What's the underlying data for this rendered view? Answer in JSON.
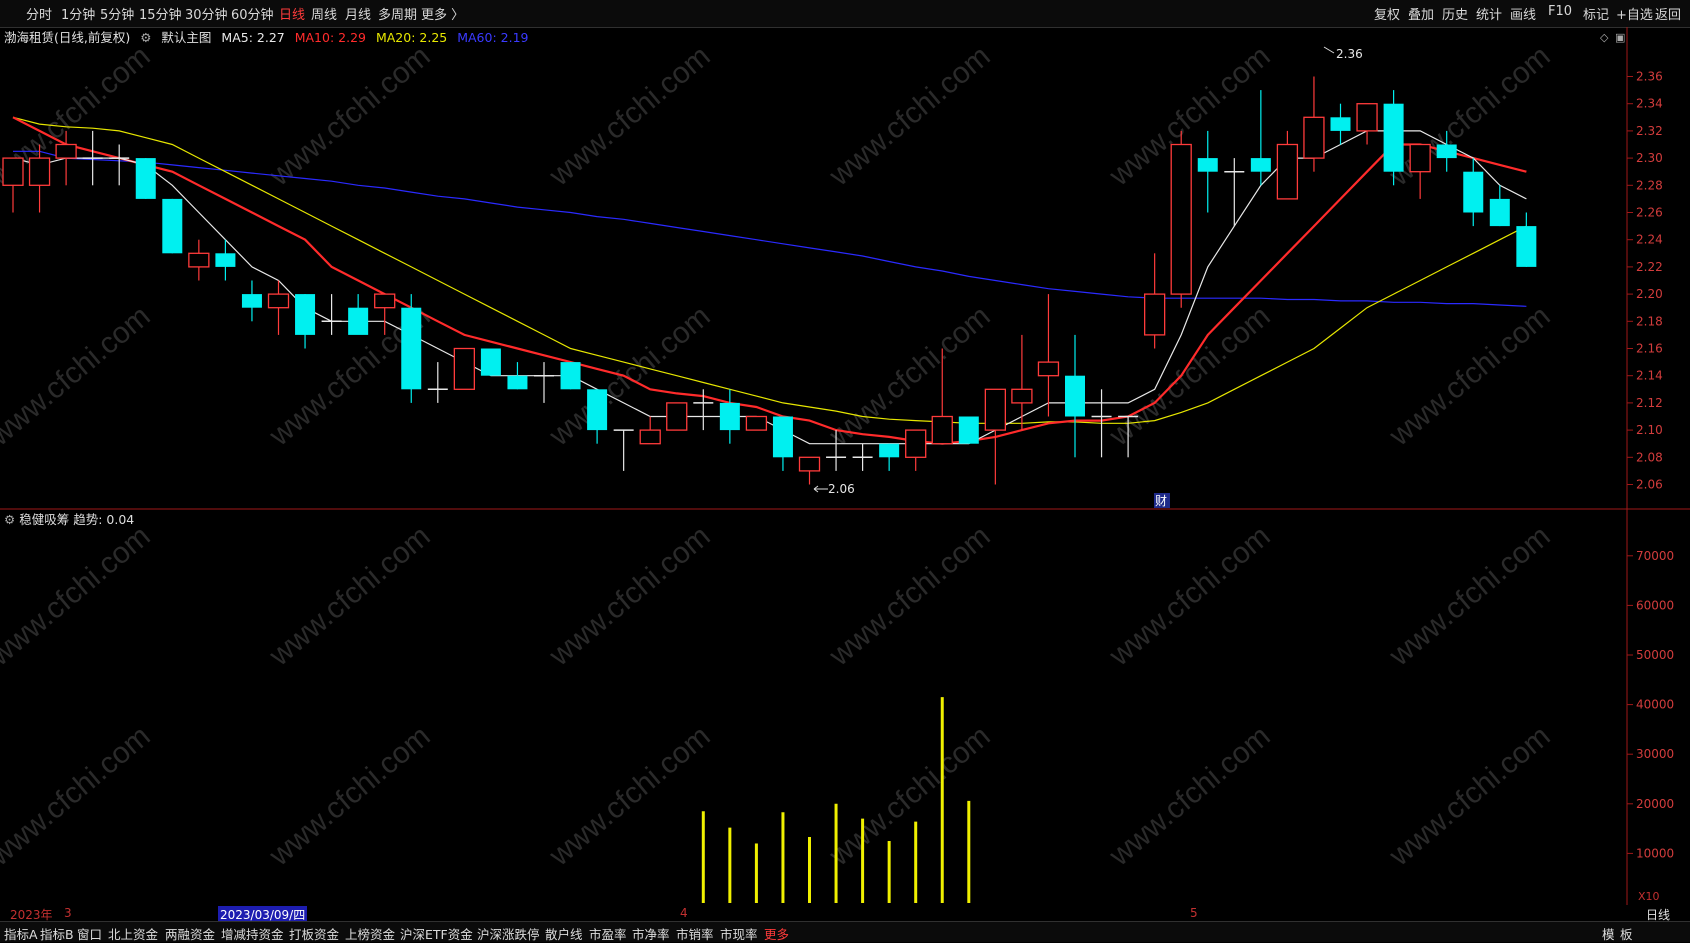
{
  "toolbar": {
    "periods": [
      "分时",
      "1分钟",
      "5分钟",
      "15分钟",
      "30分钟",
      "60分钟",
      "日线",
      "周线",
      "月线",
      "多周期",
      "更多 〉"
    ],
    "active_period": "日线",
    "right_buttons": [
      "复权",
      "叠加",
      "历史",
      "统计",
      "画线",
      "F10",
      "标记",
      "+自选",
      "返回"
    ]
  },
  "main_legend": {
    "stock": "渤海租赁(日线,前复权)",
    "template": "默认主图",
    "ma5": "MA5: 2.27",
    "ma10": "MA10: 2.29",
    "ma20": "MA20: 2.25",
    "ma60": "MA60: 2.19",
    "colors": {
      "ma5": "#e8e8e8",
      "ma10": "#ff2b2b",
      "ma20": "#e6e600",
      "ma60": "#2a2aff",
      "up": "#ff3b3b",
      "down": "#00f0f0"
    }
  },
  "indicator_legend": {
    "name": "稳健吸筹",
    "value": "趋势: 0.04"
  },
  "price_axis": [
    "2.36",
    "2.34",
    "2.32",
    "2.30",
    "2.28",
    "2.26",
    "2.24",
    "2.22",
    "2.20",
    "2.18",
    "2.16",
    "2.14",
    "2.12",
    "2.10",
    "2.08",
    "2.06"
  ],
  "indicator_axis": [
    "70000",
    "60000",
    "50000",
    "40000",
    "30000",
    "20000",
    "10000"
  ],
  "indicator_axis_unit": "X10",
  "annotations": {
    "high": "2.36",
    "low": "2.06",
    "event": "财"
  },
  "watermark": "www.cfchi.com",
  "chart_data": {
    "type": "candlestick",
    "title": "渤海租赁(日线,前复权)",
    "ylim": [
      2.05,
      2.37
    ],
    "candles": [
      {
        "o": 2.28,
        "h": 2.3,
        "l": 2.26,
        "c": 2.3
      },
      {
        "o": 2.28,
        "h": 2.31,
        "l": 2.26,
        "c": 2.3
      },
      {
        "o": 2.3,
        "h": 2.32,
        "l": 2.28,
        "c": 2.31
      },
      {
        "o": 2.3,
        "h": 2.32,
        "l": 2.28,
        "c": 2.3
      },
      {
        "o": 2.3,
        "h": 2.31,
        "l": 2.28,
        "c": 2.3
      },
      {
        "o": 2.3,
        "h": 2.3,
        "l": 2.27,
        "c": 2.27
      },
      {
        "o": 2.27,
        "h": 2.27,
        "l": 2.23,
        "c": 2.23
      },
      {
        "o": 2.22,
        "h": 2.24,
        "l": 2.21,
        "c": 2.23
      },
      {
        "o": 2.23,
        "h": 2.24,
        "l": 2.21,
        "c": 2.22
      },
      {
        "o": 2.2,
        "h": 2.21,
        "l": 2.18,
        "c": 2.19
      },
      {
        "o": 2.19,
        "h": 2.21,
        "l": 2.17,
        "c": 2.2
      },
      {
        "o": 2.2,
        "h": 2.2,
        "l": 2.16,
        "c": 2.17
      },
      {
        "o": 2.18,
        "h": 2.2,
        "l": 2.17,
        "c": 2.18
      },
      {
        "o": 2.19,
        "h": 2.2,
        "l": 2.18,
        "c": 2.17
      },
      {
        "o": 2.19,
        "h": 2.2,
        "l": 2.17,
        "c": 2.2
      },
      {
        "o": 2.19,
        "h": 2.2,
        "l": 2.12,
        "c": 2.13
      },
      {
        "o": 2.13,
        "h": 2.15,
        "l": 2.12,
        "c": 2.13
      },
      {
        "o": 2.13,
        "h": 2.16,
        "l": 2.13,
        "c": 2.16
      },
      {
        "o": 2.16,
        "h": 2.16,
        "l": 2.14,
        "c": 2.14
      },
      {
        "o": 2.14,
        "h": 2.15,
        "l": 2.13,
        "c": 2.13
      },
      {
        "o": 2.14,
        "h": 2.15,
        "l": 2.12,
        "c": 2.14
      },
      {
        "o": 2.15,
        "h": 2.15,
        "l": 2.13,
        "c": 2.13
      },
      {
        "o": 2.13,
        "h": 2.13,
        "l": 2.09,
        "c": 2.1
      },
      {
        "o": 2.1,
        "h": 2.1,
        "l": 2.07,
        "c": 2.1
      },
      {
        "o": 2.09,
        "h": 2.11,
        "l": 2.09,
        "c": 2.1
      },
      {
        "o": 2.1,
        "h": 2.12,
        "l": 2.1,
        "c": 2.12
      },
      {
        "o": 2.12,
        "h": 2.13,
        "l": 2.1,
        "c": 2.12
      },
      {
        "o": 2.12,
        "h": 2.13,
        "l": 2.09,
        "c": 2.1
      },
      {
        "o": 2.1,
        "h": 2.11,
        "l": 2.1,
        "c": 2.11
      },
      {
        "o": 2.11,
        "h": 2.11,
        "l": 2.07,
        "c": 2.08
      },
      {
        "o": 2.07,
        "h": 2.08,
        "l": 2.06,
        "c": 2.08
      },
      {
        "o": 2.08,
        "h": 2.1,
        "l": 2.07,
        "c": 2.08
      },
      {
        "o": 2.08,
        "h": 2.09,
        "l": 2.07,
        "c": 2.08
      },
      {
        "o": 2.09,
        "h": 2.09,
        "l": 2.07,
        "c": 2.08
      },
      {
        "o": 2.08,
        "h": 2.1,
        "l": 2.07,
        "c": 2.1
      },
      {
        "o": 2.09,
        "h": 2.16,
        "l": 2.09,
        "c": 2.11
      },
      {
        "o": 2.11,
        "h": 2.11,
        "l": 2.09,
        "c": 2.09
      },
      {
        "o": 2.1,
        "h": 2.13,
        "l": 2.06,
        "c": 2.13
      },
      {
        "o": 2.12,
        "h": 2.17,
        "l": 2.1,
        "c": 2.13
      },
      {
        "o": 2.14,
        "h": 2.2,
        "l": 2.11,
        "c": 2.15
      },
      {
        "o": 2.14,
        "h": 2.17,
        "l": 2.08,
        "c": 2.11
      },
      {
        "o": 2.11,
        "h": 2.13,
        "l": 2.08,
        "c": 2.11
      },
      {
        "o": 2.11,
        "h": 2.11,
        "l": 2.08,
        "c": 2.11
      },
      {
        "o": 2.17,
        "h": 2.23,
        "l": 2.16,
        "c": 2.2
      },
      {
        "o": 2.2,
        "h": 2.32,
        "l": 2.19,
        "c": 2.31
      },
      {
        "o": 2.3,
        "h": 2.32,
        "l": 2.26,
        "c": 2.29
      },
      {
        "o": 2.29,
        "h": 2.3,
        "l": 2.25,
        "c": 2.29
      },
      {
        "o": 2.3,
        "h": 2.35,
        "l": 2.28,
        "c": 2.29
      },
      {
        "o": 2.27,
        "h": 2.32,
        "l": 2.27,
        "c": 2.31
      },
      {
        "o": 2.3,
        "h": 2.36,
        "l": 2.29,
        "c": 2.33
      },
      {
        "o": 2.33,
        "h": 2.34,
        "l": 2.31,
        "c": 2.32
      },
      {
        "o": 2.32,
        "h": 2.34,
        "l": 2.31,
        "c": 2.34
      },
      {
        "o": 2.34,
        "h": 2.35,
        "l": 2.28,
        "c": 2.29
      },
      {
        "o": 2.29,
        "h": 2.31,
        "l": 2.27,
        "c": 2.31
      },
      {
        "o": 2.31,
        "h": 2.32,
        "l": 2.29,
        "c": 2.3
      },
      {
        "o": 2.29,
        "h": 2.3,
        "l": 2.25,
        "c": 2.26
      },
      {
        "o": 2.27,
        "h": 2.28,
        "l": 2.25,
        "c": 2.25
      },
      {
        "o": 2.25,
        "h": 2.26,
        "l": 2.22,
        "c": 2.22
      }
    ],
    "ma5": [
      2.3,
      2.295,
      2.3,
      2.3,
      2.3,
      2.295,
      2.28,
      2.26,
      2.24,
      2.22,
      2.21,
      2.19,
      2.18,
      2.18,
      2.18,
      2.17,
      2.16,
      2.15,
      2.14,
      2.14,
      2.14,
      2.14,
      2.13,
      2.12,
      2.11,
      2.11,
      2.11,
      2.11,
      2.11,
      2.1,
      2.09,
      2.09,
      2.09,
      2.09,
      2.09,
      2.09,
      2.09,
      2.1,
      2.11,
      2.12,
      2.12,
      2.12,
      2.12,
      2.13,
      2.17,
      2.22,
      2.25,
      2.28,
      2.3,
      2.3,
      2.31,
      2.32,
      2.32,
      2.32,
      2.31,
      2.3,
      2.28,
      2.27
    ],
    "ma10": [
      2.33,
      2.32,
      2.31,
      2.305,
      2.3,
      2.295,
      2.29,
      2.28,
      2.27,
      2.26,
      2.25,
      2.24,
      2.22,
      2.21,
      2.2,
      2.19,
      2.18,
      2.17,
      2.165,
      2.16,
      2.155,
      2.15,
      2.145,
      2.14,
      2.13,
      2.127,
      2.125,
      2.12,
      2.117,
      2.11,
      2.107,
      2.1,
      2.097,
      2.095,
      2.092,
      2.09,
      2.092,
      2.095,
      2.1,
      2.105,
      2.107,
      2.107,
      2.11,
      2.12,
      2.14,
      2.17,
      2.19,
      2.21,
      2.23,
      2.25,
      2.27,
      2.29,
      2.31,
      2.31,
      2.305,
      2.3,
      2.295,
      2.29
    ],
    "ma20": [
      2.33,
      2.325,
      2.323,
      2.322,
      2.32,
      2.315,
      2.31,
      2.3,
      2.29,
      2.28,
      2.27,
      2.26,
      2.25,
      2.24,
      2.23,
      2.22,
      2.21,
      2.2,
      2.19,
      2.18,
      2.17,
      2.16,
      2.155,
      2.15,
      2.145,
      2.14,
      2.135,
      2.13,
      2.125,
      2.12,
      2.117,
      2.114,
      2.11,
      2.108,
      2.107,
      2.106,
      2.105,
      2.105,
      2.105,
      2.106,
      2.106,
      2.105,
      2.105,
      2.107,
      2.113,
      2.12,
      2.13,
      2.14,
      2.15,
      2.16,
      2.175,
      2.19,
      2.2,
      2.21,
      2.22,
      2.23,
      2.24,
      2.25
    ],
    "ma60": [
      2.305,
      2.305,
      2.3,
      2.299,
      2.298,
      2.297,
      2.295,
      2.293,
      2.291,
      2.289,
      2.287,
      2.285,
      2.283,
      2.28,
      2.278,
      2.275,
      2.272,
      2.27,
      2.267,
      2.264,
      2.262,
      2.26,
      2.257,
      2.255,
      2.252,
      2.249,
      2.246,
      2.243,
      2.24,
      2.237,
      2.234,
      2.231,
      2.228,
      2.224,
      2.22,
      2.217,
      2.213,
      2.21,
      2.207,
      2.204,
      2.202,
      2.2,
      2.198,
      2.197,
      2.197,
      2.197,
      2.197,
      2.197,
      2.196,
      2.196,
      2.195,
      2.195,
      2.194,
      2.194,
      2.193,
      2.193,
      2.192,
      2.191
    ],
    "indicator": {
      "name": "稳健吸筹",
      "bars": [
        {
          "i": 26,
          "v": 18500
        },
        {
          "i": 27,
          "v": 15200
        },
        {
          "i": 28,
          "v": 12000
        },
        {
          "i": 29,
          "v": 18300
        },
        {
          "i": 30,
          "v": 13300
        },
        {
          "i": 31,
          "v": 20000
        },
        {
          "i": 32,
          "v": 17000
        },
        {
          "i": 33,
          "v": 12500
        },
        {
          "i": 34,
          "v": 16400
        },
        {
          "i": 35,
          "v": 41500
        },
        {
          "i": 36,
          "v": 20600
        }
      ],
      "ylim": [
        0,
        75000
      ]
    }
  },
  "date_bar": {
    "year": "2023年",
    "m3": "3",
    "date": "2023/03/09/四",
    "m4": "4",
    "m5": "5",
    "period": "日线"
  },
  "bottom_tabs": [
    "指标A",
    "指标B",
    "窗口",
    "北上资金",
    "两融资金",
    "增减持资金",
    "打板资金",
    "上榜资金",
    "沪深ETF资金",
    "沪深涨跌停",
    "散户线",
    "市盈率",
    "市净率",
    "市销率",
    "市现率",
    "更多"
  ],
  "bottom_right": [
    "模",
    "板"
  ]
}
